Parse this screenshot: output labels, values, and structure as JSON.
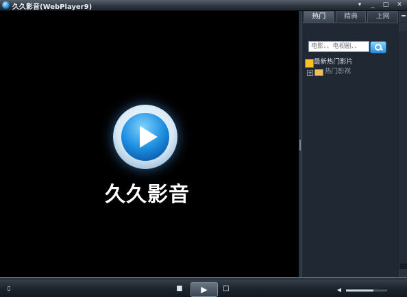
{
  "window": {
    "title": "久久影音(WebPlayer9)",
    "buttons": {
      "menu": "▾",
      "minimize": "_",
      "maximize": "□",
      "close": "✕"
    }
  },
  "player": {
    "brand": "久久影音"
  },
  "side_panel": {
    "tabs": [
      {
        "label": "热门",
        "active": true
      },
      {
        "label": "精典",
        "active": false
      },
      {
        "label": "上网",
        "active": false
      }
    ],
    "search": {
      "placeholder": "电影、、电视剧、、"
    },
    "tree": [
      {
        "label": "最新热门影片",
        "icon": "star-icon"
      },
      {
        "label": "热门影视",
        "icon": "folder-icon"
      }
    ]
  },
  "controls": {
    "stop_label": "■",
    "play_label": "▶",
    "next_label": "□",
    "volume_label": "◀"
  },
  "volume": {
    "level": 0.67
  }
}
